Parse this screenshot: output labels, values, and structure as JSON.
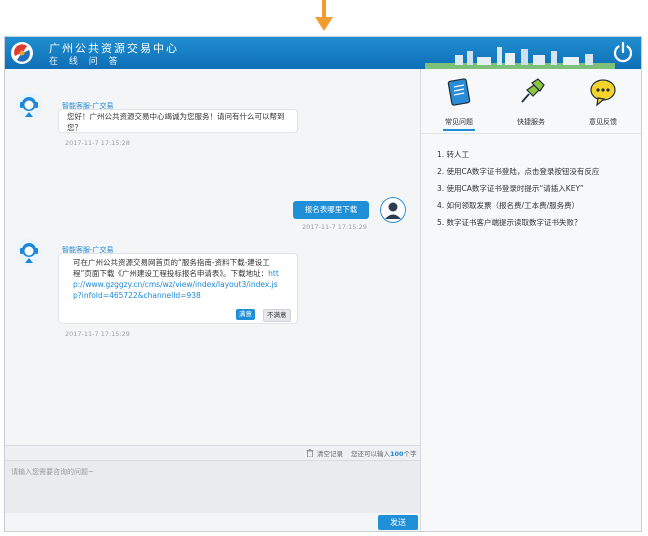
{
  "header": {
    "title": "广州公共资源交易中心",
    "subtitle": "在 线 问 答"
  },
  "chat": {
    "messages": [
      {
        "sender": "智能客服-广交易",
        "text": "您好！广州公共资源交易中心竭诚为您服务！请问有什么可以帮到您？",
        "time": "2017-11-7 17:15:28"
      },
      {
        "user_text": "报名表哪里下载",
        "time": "2017-11-7 17:15:29"
      },
      {
        "sender": "智能客服-广交易",
        "text_before": "可在广州公共资源交易网首页的“服务指南-资料下载-建设工程”页面下载《广州建设工程投标报名申请表》。下载地址：",
        "link": "http://www.gzggzy.cn/cms/wz/view/index/layout3/index.jsp?infoId=465722&channelId=938",
        "satisfied": "满意",
        "unsatisfied": "不满意",
        "time": "2017-11-7 17:15:29"
      }
    ]
  },
  "toolbar": {
    "clear_label": "清空记录",
    "limit_prefix": "您还可以输入",
    "limit_count": "100",
    "limit_suffix": "个字"
  },
  "input": {
    "placeholder": "请输入您需要咨询的问题~",
    "send_label": "发送"
  },
  "side": {
    "tabs": [
      {
        "label": "常见问题",
        "icon": "document-icon"
      },
      {
        "label": "快捷服务",
        "icon": "pin-icon"
      },
      {
        "label": "意见反馈",
        "icon": "speech-bubble-icon"
      }
    ],
    "faq": [
      "1. 转人工",
      "2. 使用CA数字证书登陆，点击登录按钮没有反应",
      "3. 使用CA数字证书登录时提示“请插入KEY”",
      "4. 如何领取发票（报名费/工本费/服务费）",
      "5. 数字证书客户端提示读取数字证书失败？"
    ]
  },
  "colors": {
    "accent": "#1f8fd8",
    "arrow": "#f39c32"
  }
}
